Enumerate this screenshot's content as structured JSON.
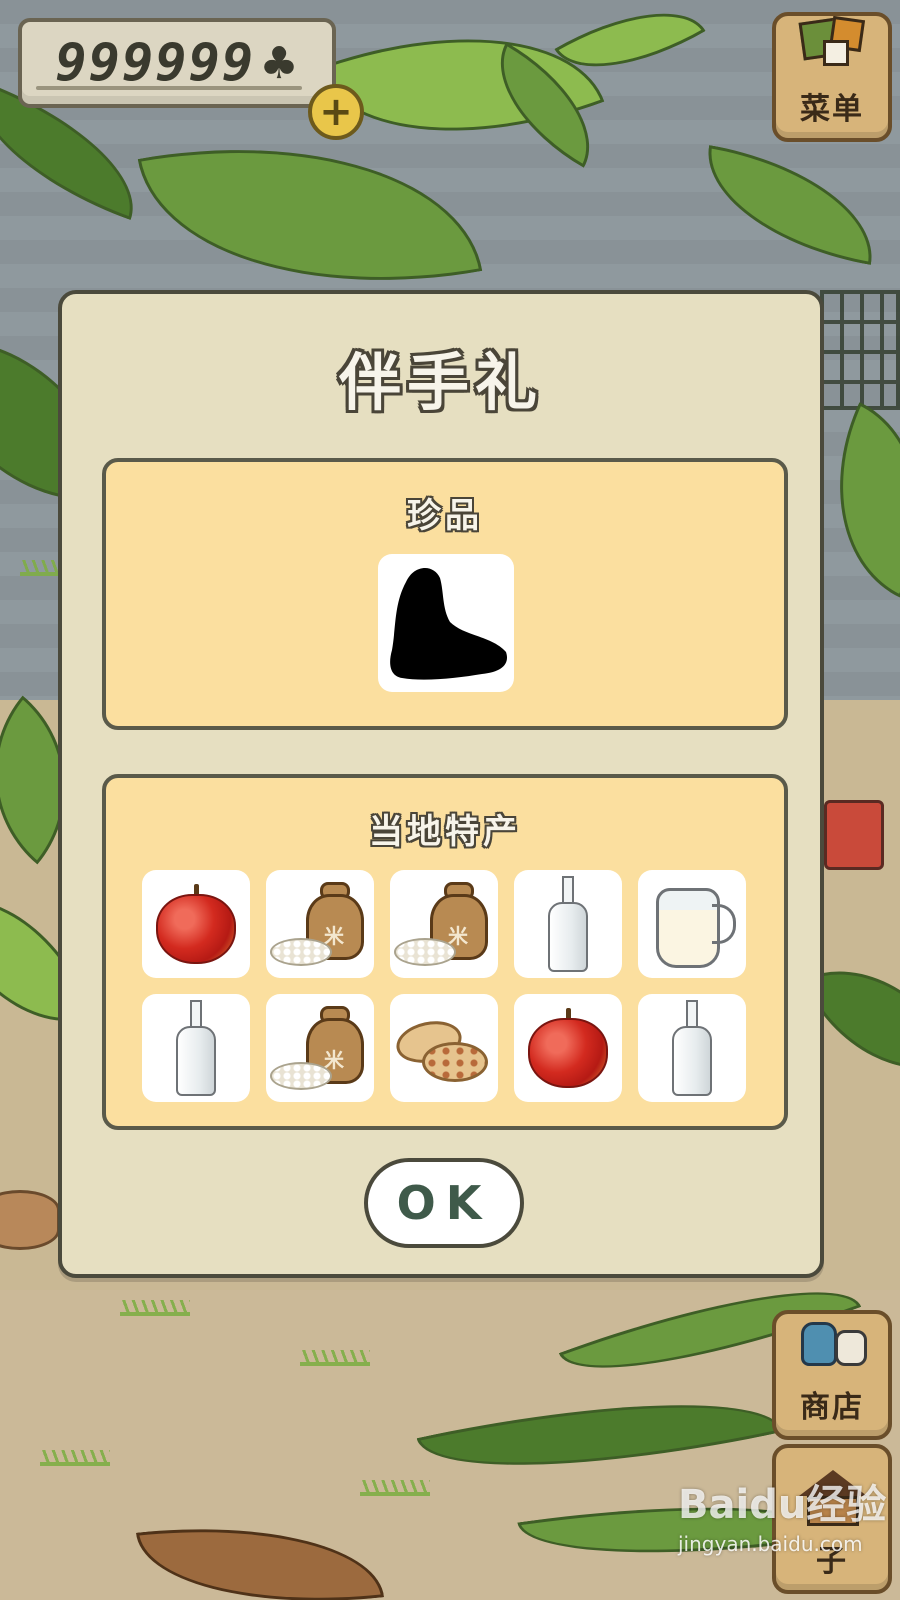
{
  "hud": {
    "clover_count": "999999",
    "clover_symbol": "♣",
    "add_symbol": "+"
  },
  "side_buttons": {
    "menu_label": "菜单",
    "shop_label": "商店",
    "home_label": "子"
  },
  "dialog": {
    "title": "伴手礼",
    "rare_section": {
      "title": "珍品",
      "item": "silhouette"
    },
    "local_section": {
      "title": "当地特产",
      "items": [
        "apple-icon",
        "rice-bag-icon",
        "rice-bag-icon",
        "bottle-icon",
        "milk-jug-icon",
        "bottle-icon",
        "rice-bag-icon",
        "biscuit-icon",
        "apple-icon",
        "bottle-icon"
      ]
    },
    "ok_label": "OK"
  },
  "watermark": {
    "brand": "Baidu经验",
    "url": "jingyan.baidu.com"
  },
  "colors": {
    "dialog_bg": "#e6dfc1",
    "section_bg": "#fbdf9f",
    "tile_bg": "#ffffff",
    "ok_text": "#3f5a4a"
  }
}
